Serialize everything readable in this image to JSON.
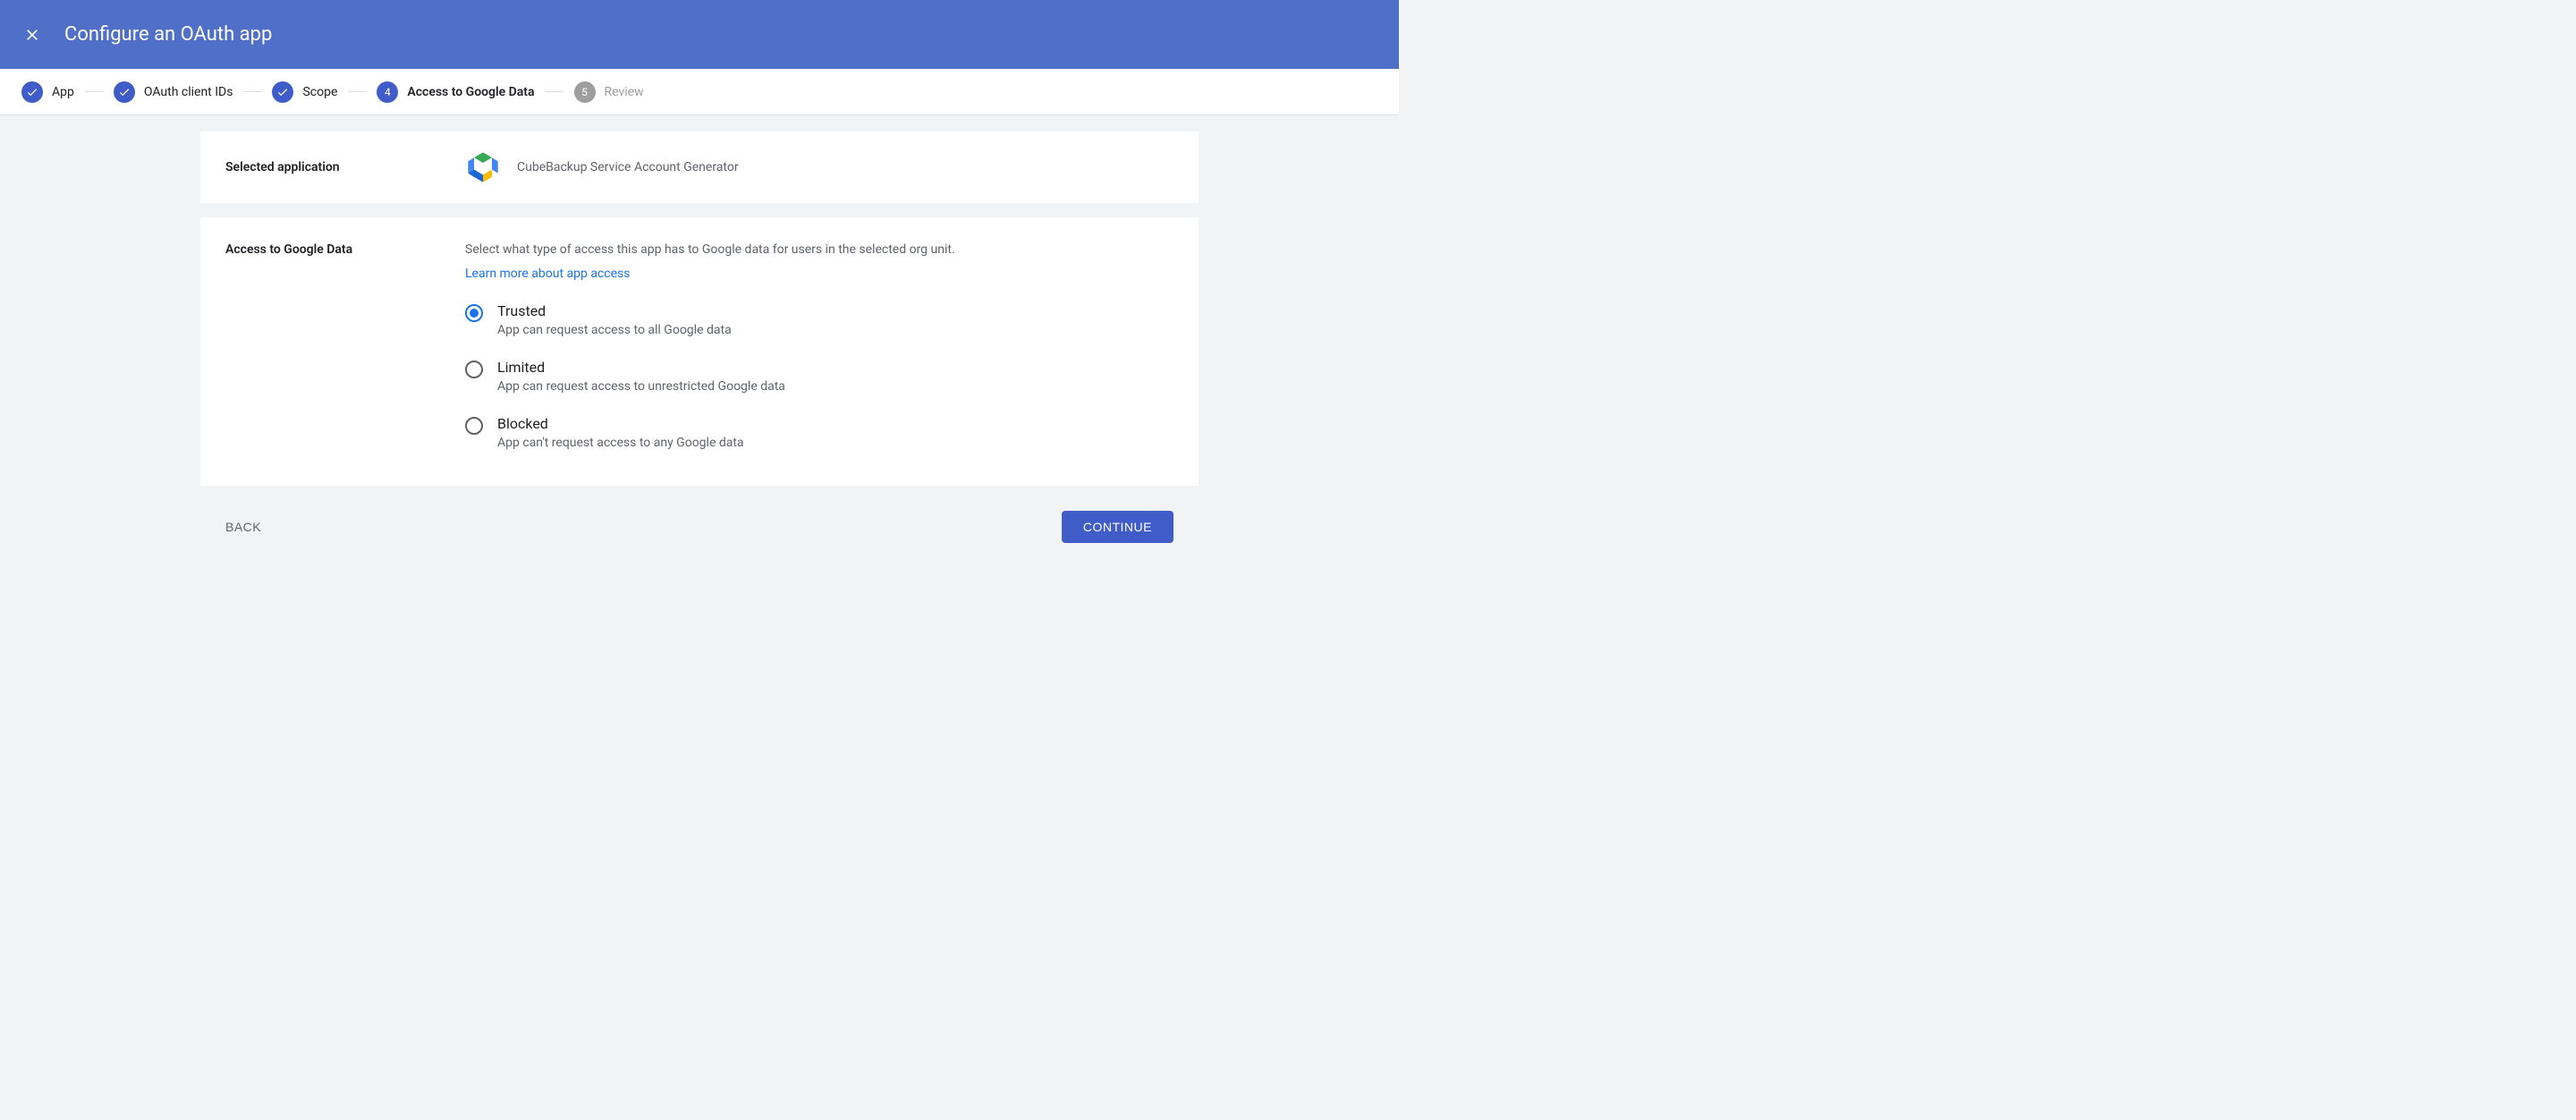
{
  "header": {
    "title": "Configure an OAuth app"
  },
  "stepper": {
    "steps": [
      {
        "label": "App",
        "state": "done"
      },
      {
        "label": "OAuth client IDs",
        "state": "done"
      },
      {
        "label": "Scope",
        "state": "done"
      },
      {
        "label": "Access to Google Data",
        "state": "current",
        "number": "4"
      },
      {
        "label": "Review",
        "state": "pending",
        "number": "5"
      }
    ]
  },
  "selected_card": {
    "label": "Selected application",
    "app_name": "CubeBackup Service Account Generator"
  },
  "access_card": {
    "title": "Access to Google Data",
    "description": "Select what type of access this app has to Google data for users in the selected org unit.",
    "learn_more": "Learn more about app access",
    "options": [
      {
        "title": "Trusted",
        "sub": "App can request access to all Google data",
        "selected": true
      },
      {
        "title": "Limited",
        "sub": "App can request access to unrestricted Google data",
        "selected": false
      },
      {
        "title": "Blocked",
        "sub": "App can't request access to any Google data",
        "selected": false
      }
    ]
  },
  "footer": {
    "back": "BACK",
    "continue": "CONTINUE"
  }
}
